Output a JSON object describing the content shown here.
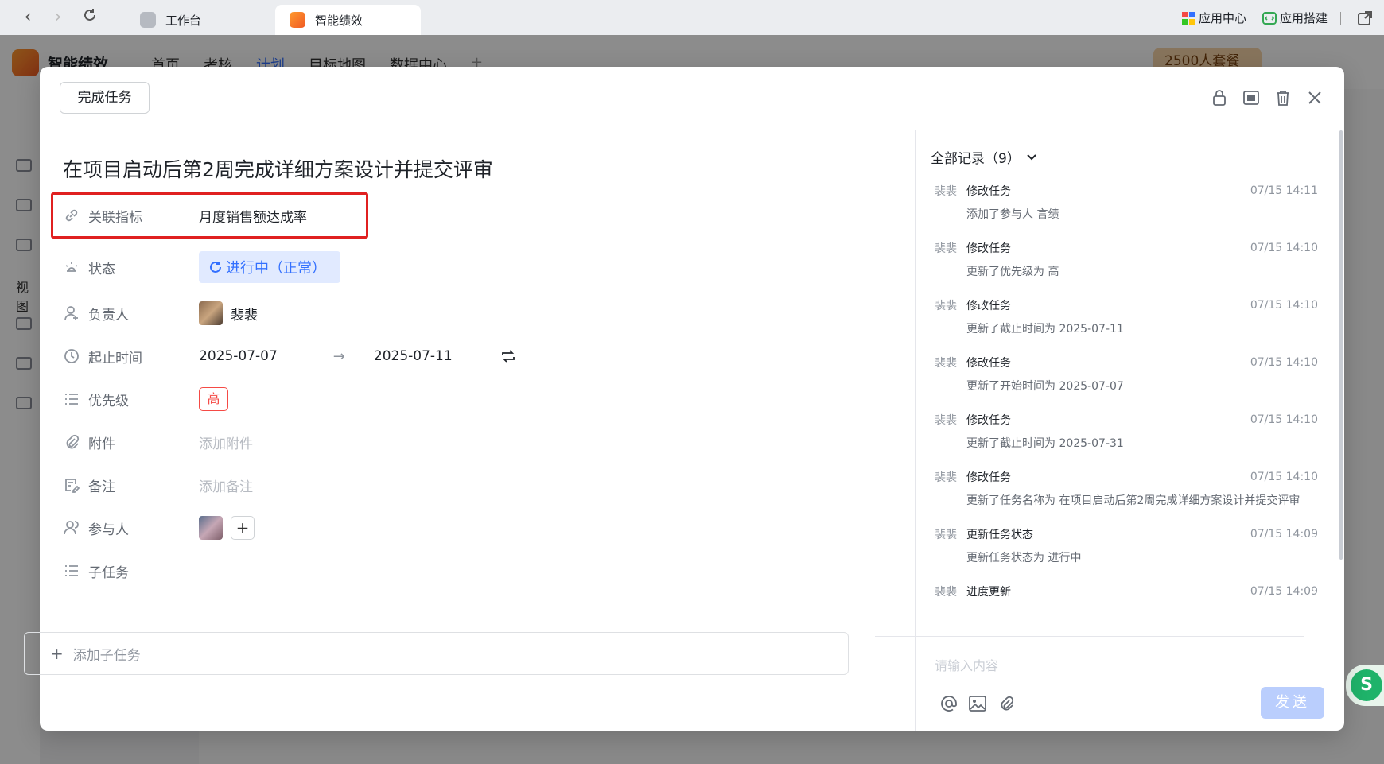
{
  "browser": {
    "tabs": [
      {
        "label": "工作台"
      },
      {
        "label": "智能绩效"
      }
    ],
    "right_items": [
      {
        "label": "应用中心"
      },
      {
        "label": "应用搭建"
      }
    ]
  },
  "app": {
    "name": "智能绩效",
    "nav": [
      "首页",
      "考核",
      "计划",
      "目标地图",
      "数据中心"
    ],
    "plan_badge": "2500人套餐",
    "sidebar_label": "视图"
  },
  "modal": {
    "complete_button": "完成任务",
    "task_title": "在项目启动后第2周完成详细方案设计并提交评审",
    "fields": {
      "linked_metric": {
        "label": "关联指标",
        "value": "月度销售额达成率"
      },
      "status": {
        "label": "状态",
        "value": "进行中（正常）"
      },
      "owner": {
        "label": "负责人",
        "value": "裴裴"
      },
      "dates": {
        "label": "起止时间",
        "start": "2025-07-07",
        "end": "2025-07-11"
      },
      "priority": {
        "label": "优先级",
        "value": "高"
      },
      "attachment": {
        "label": "附件",
        "placeholder": "添加附件"
      },
      "note": {
        "label": "备注",
        "placeholder": "添加备注"
      },
      "participants": {
        "label": "参与人"
      },
      "subtasks": {
        "label": "子任务",
        "add_label": "添加子任务"
      }
    }
  },
  "records": {
    "header": "全部记录（9）",
    "items": [
      {
        "user": "裴裴",
        "action": "修改任务",
        "time": "07/15 14:11",
        "desc": "添加了参与人 言绩"
      },
      {
        "user": "裴裴",
        "action": "修改任务",
        "time": "07/15 14:10",
        "desc": "更新了优先级为 高"
      },
      {
        "user": "裴裴",
        "action": "修改任务",
        "time": "07/15 14:10",
        "desc": "更新了截止时间为 2025-07-11"
      },
      {
        "user": "裴裴",
        "action": "修改任务",
        "time": "07/15 14:10",
        "desc": "更新了开始时间为 2025-07-07"
      },
      {
        "user": "裴裴",
        "action": "修改任务",
        "time": "07/15 14:10",
        "desc": "更新了截止时间为 2025-07-31"
      },
      {
        "user": "裴裴",
        "action": "修改任务",
        "time": "07/15 14:10",
        "desc": "更新了任务名称为 在项目启动后第2周完成详细方案设计并提交评审"
      },
      {
        "user": "裴裴",
        "action": "更新任务状态",
        "time": "07/15 14:09",
        "desc": "更新任务状态为 进行中"
      },
      {
        "user": "裴裴",
        "action": "进度更新",
        "time": "07/15 14:09",
        "desc": ""
      }
    ],
    "comment_placeholder": "请输入内容",
    "send_label": "发送"
  }
}
